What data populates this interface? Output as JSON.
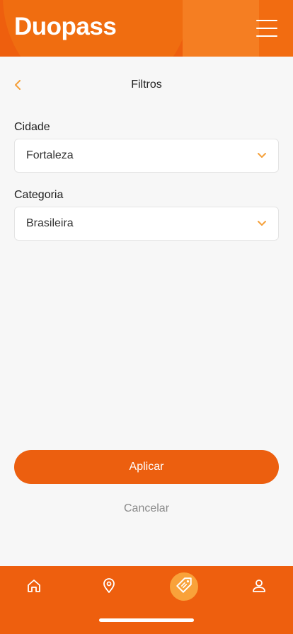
{
  "header": {
    "logo": "Duopass",
    "menu_icon": "hamburger-menu-icon"
  },
  "page": {
    "title": "Filtros",
    "back_icon": "chevron-left-icon"
  },
  "filters": {
    "city": {
      "label": "Cidade",
      "value": "Fortaleza"
    },
    "category": {
      "label": "Categoria",
      "value": "Brasileira"
    }
  },
  "actions": {
    "apply": "Aplicar",
    "cancel": "Cancelar"
  },
  "bottom_nav": {
    "items": [
      {
        "icon": "home-icon",
        "active": false
      },
      {
        "icon": "map-pin-icon",
        "active": false
      },
      {
        "icon": "tag-icon",
        "active": true
      },
      {
        "icon": "user-icon",
        "active": false
      }
    ]
  },
  "colors": {
    "brand": "#ee5f0e",
    "accent": "#f9a23a",
    "chevron": "#f5a03a"
  }
}
